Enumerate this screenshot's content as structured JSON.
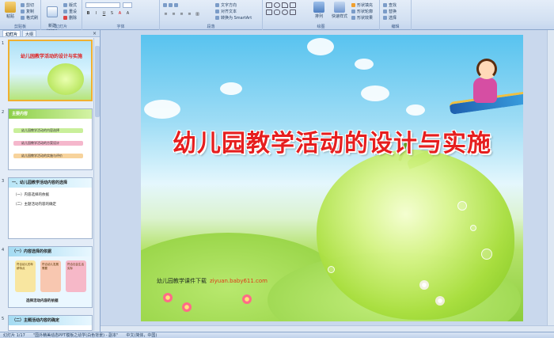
{
  "ribbon": {
    "groups": [
      {
        "label": "剪贴板"
      },
      {
        "label": "幻灯片"
      },
      {
        "label": "字体"
      },
      {
        "label": "段落"
      },
      {
        "label": "绘图"
      },
      {
        "label": "编辑"
      }
    ],
    "paste_label": "粘贴",
    "cut_label": "剪切",
    "copy_label": "复制",
    "format_painter_label": "格式刷",
    "new_slide_label": "新建\n幻灯片",
    "layout_label": "版式",
    "reset_label": "重设",
    "delete_label": "删除",
    "text_direction_label": "文字方向",
    "align_text_label": "对齐文本",
    "smartart_label": "转换为 SmartArt",
    "arrange_label": "排列",
    "quick_styles_label": "快速样式",
    "shape_fill_label": "形状填充",
    "shape_outline_label": "形状轮廓",
    "shape_effects_label": "形状效果",
    "find_label": "查找",
    "replace_label": "替换",
    "select_label": "选择"
  },
  "pane": {
    "tab_slides": "幻灯片",
    "tab_outline": "大纲",
    "close": "×",
    "slides": [
      {
        "num": "1",
        "title": "幼儿园教学活动的设计与实施"
      },
      {
        "num": "2",
        "title": "主要内容",
        "items": [
          "幼儿园教学活动的内容选择",
          "幼儿园教学活动的方案设计",
          "幼儿园教学活动的实施与评价"
        ]
      },
      {
        "num": "3",
        "title": "一、幼儿园教学活动内容的选择",
        "items": [
          "（一）内容选择的依据",
          "（二）主题活动内容的确定"
        ]
      },
      {
        "num": "4",
        "title": "（一）内容选择的依据",
        "cols": [
          "符合幼儿的年龄特点",
          "符合幼儿发展需要",
          "符合社会生活实际"
        ],
        "footer": "选择活动内容的依据"
      },
      {
        "num": "5",
        "title": "（二）主题活动内容的确定"
      }
    ]
  },
  "slide": {
    "title": "幼儿园教学活动的设计与实施",
    "credit_text": "幼儿园教学课件下载",
    "credit_url": "ziyuan.baby611.com"
  },
  "status": {
    "slide_counter": "幻灯片 1/17",
    "theme": "\"国外精美动态PPT模板之幼学(白色背景) - 副本\"",
    "language": "中文(简体，中国)"
  },
  "colors": {
    "title_red": "#e61e1e",
    "ribbon_bg": "#d2e0f2",
    "selection_border": "#f0b030"
  }
}
